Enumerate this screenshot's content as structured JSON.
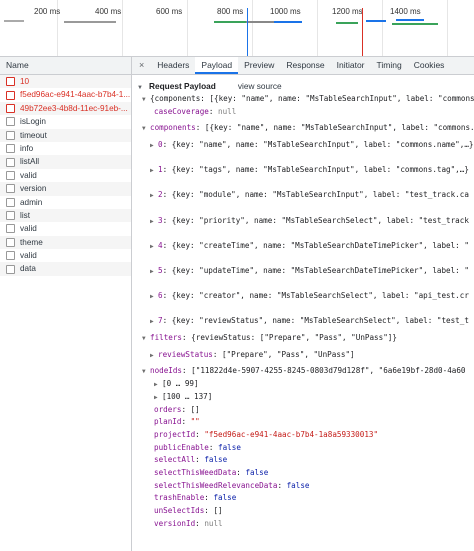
{
  "timeline": {
    "ticks": [
      "200 ms",
      "400 ms",
      "600 ms",
      "800 ms",
      "1000 ms",
      "1200 ms",
      "1400 ms"
    ]
  },
  "requests_header": "Name",
  "requests": [
    {
      "name": "10",
      "error": true
    },
    {
      "name": "f5ed96ac-e941-4aac-b7b4-1...",
      "error": true
    },
    {
      "name": "49b72ee3-4b8d-11ec-91eb-...",
      "error": true
    },
    {
      "name": "isLogin",
      "error": false
    },
    {
      "name": "timeout",
      "error": false
    },
    {
      "name": "info",
      "error": false
    },
    {
      "name": "listAll",
      "error": false
    },
    {
      "name": "valid",
      "error": false
    },
    {
      "name": "version",
      "error": false
    },
    {
      "name": "admin",
      "error": false
    },
    {
      "name": "list",
      "error": false
    },
    {
      "name": "valid",
      "error": false
    },
    {
      "name": "theme",
      "error": false
    },
    {
      "name": "valid",
      "error": false
    },
    {
      "name": "data",
      "error": false
    }
  ],
  "tabs": {
    "close": "×",
    "items": [
      "Headers",
      "Payload",
      "Preview",
      "Response",
      "Initiator",
      "Timing",
      "Cookies"
    ],
    "active": "Payload"
  },
  "payload": {
    "section_title": "Request Payload",
    "view_source": "view source",
    "summary": "{components: [{key: \"name\", name: \"MsTableSearchInput\", label: \"commons.n",
    "caseCoverage_key": "caseCoverage",
    "caseCoverage_val": "null",
    "components_key": "components",
    "components_summary": "[{key: \"name\", name: \"MsTableSearchInput\", label: \"commons.name\"",
    "components": [
      {
        "idx": "0",
        "text": "{key: \"name\", name: \"MsTableSearchInput\", label: \"commons.name\",…}"
      },
      {
        "idx": "1",
        "text": "{key: \"tags\", name: \"MsTableSearchInput\", label: \"commons.tag\",…}"
      },
      {
        "idx": "2",
        "text": "{key: \"module\", name: \"MsTableSearchInput\", label: \"test_track.ca"
      },
      {
        "idx": "3",
        "text": "{key: \"priority\", name: \"MsTableSearchSelect\", label: \"test_track"
      },
      {
        "idx": "4",
        "text": "{key: \"createTime\", name: \"MsTableSearchDateTimePicker\", label: \""
      },
      {
        "idx": "5",
        "text": "{key: \"updateTime\", name: \"MsTableSearchDateTimePicker\", label: \""
      },
      {
        "idx": "6",
        "text": "{key: \"creator\", name: \"MsTableSearchSelect\", label: \"api_test.cr"
      },
      {
        "idx": "7",
        "text": "{key: \"reviewStatus\", name: \"MsTableSearchSelect\", label: \"test_t"
      }
    ],
    "filters_key": "filters",
    "filters_summary": "{reviewStatus: [\"Prepare\", \"Pass\", \"UnPass\"]}",
    "reviewStatus_key": "reviewStatus",
    "reviewStatus_val": "[\"Prepare\", \"Pass\", \"UnPass\"]",
    "nodeIds_key": "nodeIds",
    "nodeIds_summary": "[\"11822d4e-5907-4255-8245-0803d79d128f\", \"6a6e19bf-28d0-4a60",
    "range1": "[0 … 99]",
    "range2": "[100 … 137]",
    "orders_key": "orders",
    "orders_val": "[]",
    "planId_key": "planId",
    "planId_val": "\"\"",
    "projectId_key": "projectId",
    "projectId_val": "\"f5ed96ac-e941-4aac-b7b4-1a8a59330013\"",
    "publicEnable_key": "publicEnable",
    "publicEnable_val": "false",
    "selectAll_key": "selectAll",
    "selectAll_val": "false",
    "selectThisWeedData_key": "selectThisWeedData",
    "selectThisWeedData_val": "false",
    "selectThisWeedRelevanceData_key": "selectThisWeedRelevanceData",
    "selectThisWeedRelevanceData_val": "false",
    "trashEnable_key": "trashEnable",
    "trashEnable_val": "false",
    "unSelectIds_key": "unSelectIds",
    "unSelectIds_val": "[]",
    "versionId_key": "versionId",
    "versionId_val": "null"
  }
}
